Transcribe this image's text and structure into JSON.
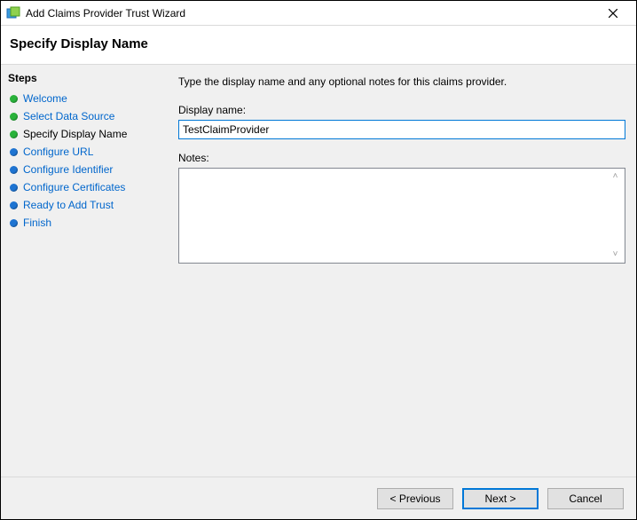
{
  "window": {
    "title": "Add Claims Provider Trust Wizard"
  },
  "header": {
    "title": "Specify Display Name"
  },
  "sidebar": {
    "title": "Steps",
    "items": [
      {
        "label": "Welcome",
        "state": "done"
      },
      {
        "label": "Select Data Source",
        "state": "done"
      },
      {
        "label": "Specify Display Name",
        "state": "current"
      },
      {
        "label": "Configure URL",
        "state": "pending"
      },
      {
        "label": "Configure Identifier",
        "state": "pending"
      },
      {
        "label": "Configure Certificates",
        "state": "pending"
      },
      {
        "label": "Ready to Add Trust",
        "state": "pending"
      },
      {
        "label": "Finish",
        "state": "pending"
      }
    ]
  },
  "content": {
    "instruction": "Type the display name and any optional notes for this claims provider.",
    "display_name_label": "Display name:",
    "display_name_value": "TestClaimProvider",
    "notes_label": "Notes:",
    "notes_value": ""
  },
  "footer": {
    "previous": "< Previous",
    "next": "Next >",
    "cancel": "Cancel"
  }
}
